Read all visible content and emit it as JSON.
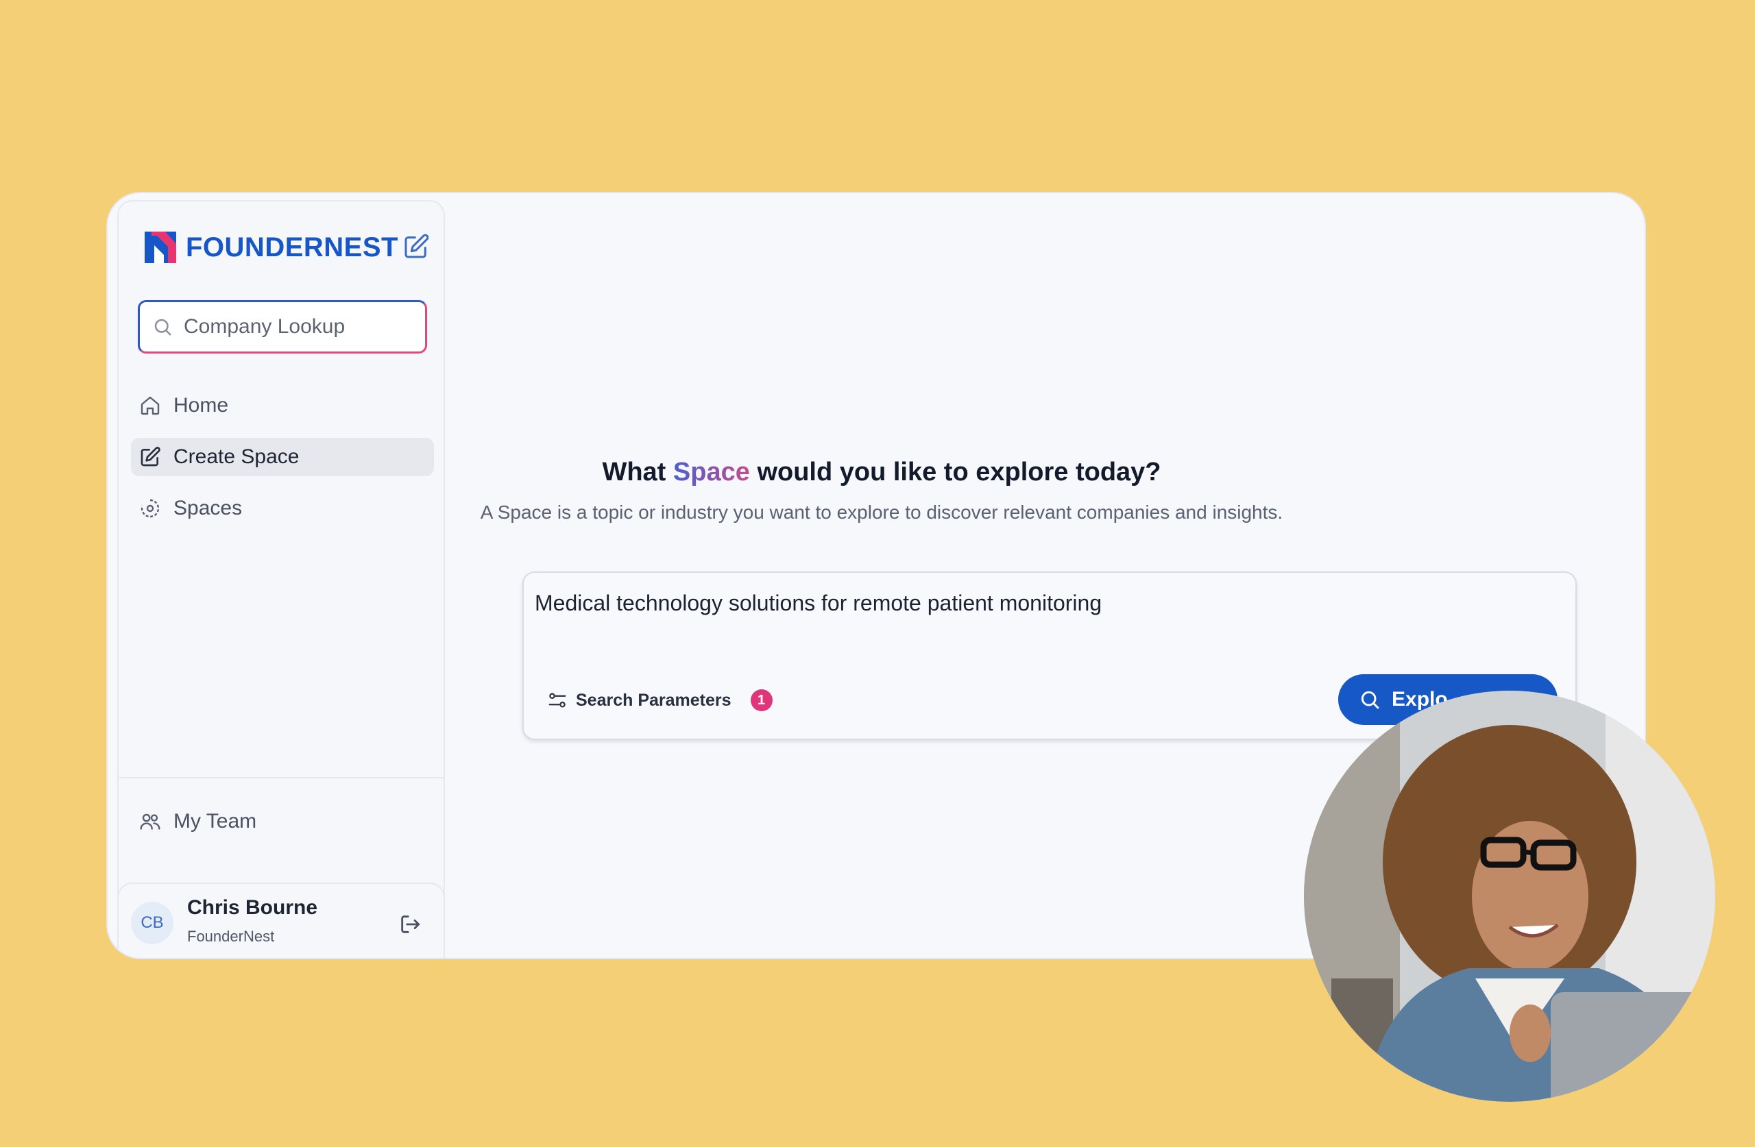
{
  "brand": {
    "name": "FOUNDERNEST"
  },
  "search": {
    "placeholder": "Company Lookup"
  },
  "nav": {
    "items": [
      {
        "label": "Home",
        "icon": "home-icon"
      },
      {
        "label": "Create Space",
        "icon": "edit-icon"
      },
      {
        "label": "Spaces",
        "icon": "spaces-icon"
      }
    ],
    "team_label": "My Team"
  },
  "user": {
    "name": "Chris Bourne",
    "org": "FounderNest",
    "initials": "CB"
  },
  "main": {
    "heading_pre": "What",
    "heading_accent": "Space",
    "heading_post": "would you like to explore today?",
    "subheading": "A Space is a topic or industry you want to explore to discover relevant companies and insights.",
    "prompt_value": "Medical technology solutions for remote patient monitoring",
    "params_label": "Search Parameters",
    "params_count": "1",
    "explore_label": "Explo"
  },
  "colors": {
    "background": "#f4cf75",
    "brand_blue": "#1656c8",
    "accent_pink": "#e0357a",
    "button_blue": "#1558c6"
  }
}
